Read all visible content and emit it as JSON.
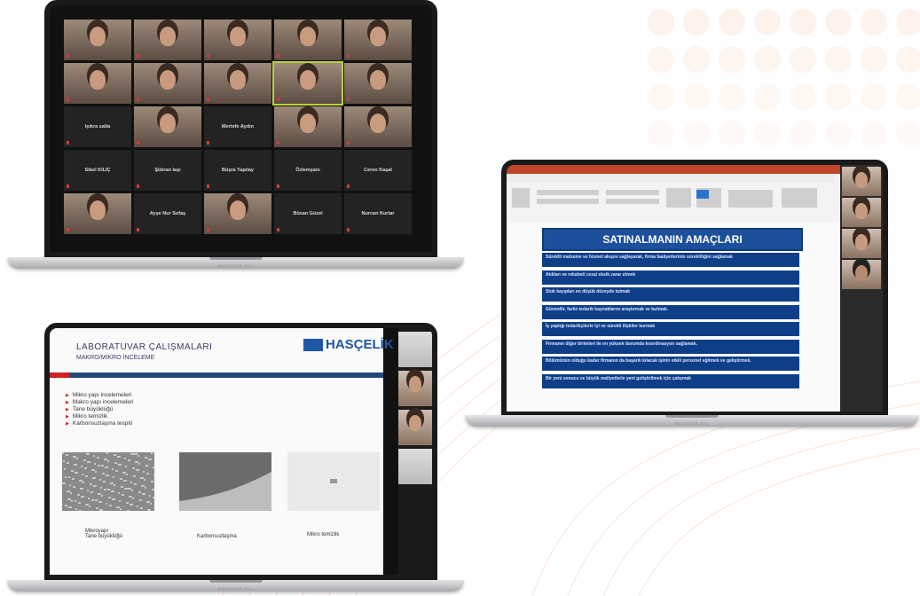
{
  "laptop1": {
    "brand": "MACBOOK Pro",
    "tiles": [
      {
        "type": "video"
      },
      {
        "type": "video"
      },
      {
        "type": "video"
      },
      {
        "type": "video"
      },
      {
        "type": "video"
      },
      {
        "type": "video"
      },
      {
        "type": "video"
      },
      {
        "type": "video"
      },
      {
        "type": "video",
        "highlight": true
      },
      {
        "type": "video"
      },
      {
        "type": "name",
        "label": "Işıkra salta"
      },
      {
        "type": "video"
      },
      {
        "type": "name",
        "label": "Mertefe Aydın"
      },
      {
        "type": "video"
      },
      {
        "type": "video"
      },
      {
        "type": "name",
        "label": "Sibel KILIÇ"
      },
      {
        "type": "name",
        "label": "Şükran Iaşı"
      },
      {
        "type": "name",
        "label": "Büşra Yapılay"
      },
      {
        "type": "name",
        "label": "Özlemşanı"
      },
      {
        "type": "name",
        "label": "Ceren Kaşal"
      },
      {
        "type": "video"
      },
      {
        "type": "name",
        "label": "Ayşe Nur Sofaş"
      },
      {
        "type": "video"
      },
      {
        "type": "name",
        "label": "Büsan Güzel"
      },
      {
        "type": "name",
        "label": "Nurcan Kurtar"
      }
    ]
  },
  "laptop2": {
    "brand": "MACBOOK Pro",
    "slide_title": "SATINALMANIN AMAÇLARI",
    "items": [
      "Süreklli malzeme ve hizmet akışını sağlayarak, firma faaliyetlerinin sürekliliğini sağlamak",
      "Atıkları ve rekabeti cezai eksik zarar etmek",
      "Stok kayıpları en düşük düzeyde tutmak",
      "Güvenilir, farklı tedarik kaynaklarını araştırmak ve bulmak.",
      "İş yaptığı tedarikçilerle iyi ve sürekli ilişkiler kurmak",
      "Firmanın diğer birimleri ile en yüksek durumda koordinasyon sağlamak.",
      "Bölümünün olduğu kadar firmanın da başarılı kılacak işinin etkili personel eğitmek ve geliştirmek.",
      "Bir yeni sonucu ve büyük maliyetlerle yeni geliştirilmek için çalışmak"
    ]
  },
  "laptop3": {
    "brand": "MACBOOK Pro",
    "title": "LABORATUVAR ÇALIŞMALARI",
    "subtitle": "MAKRO/MİKRO İNCELEME",
    "logo": "HASÇELİK",
    "bullets": [
      "Mikro yapı incelemeleri",
      "Makro yapı incelemeleri",
      "Tane büyüklüğü",
      "Mikro temizlik",
      "Karbonsuzlaşma tespiti"
    ],
    "captions": [
      "Mikroyapı\nTane büyüklüğü",
      "Karbonsuzlaşma",
      "Mikro temizlik"
    ]
  }
}
